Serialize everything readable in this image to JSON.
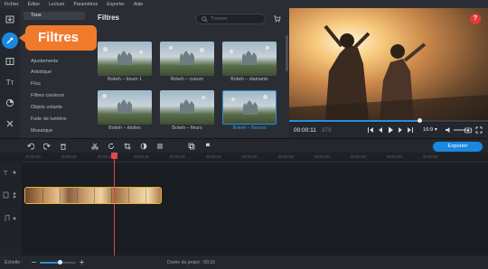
{
  "menu": [
    "Fichier",
    "Éditer",
    "Lecture",
    "Paramètres",
    "Exporter",
    "Aide"
  ],
  "tools": [
    {
      "name": "import-icon"
    },
    {
      "name": "filters-tool-icon",
      "active": true
    },
    {
      "name": "transitions-icon"
    },
    {
      "name": "titles-icon",
      "label": "Tт"
    },
    {
      "name": "stickers-icon"
    },
    {
      "name": "more-tools-icon"
    }
  ],
  "categories": [
    "Tous",
    "Ajustements",
    "Artistique",
    "Flou",
    "Filtres couleurs",
    "Objets volants",
    "Fuite de lumière",
    "Mosaïque"
  ],
  "filters_panel": {
    "title": "Filtres",
    "search_placeholder": "Trouver",
    "items": [
      {
        "label": "Bokeh – boum 1",
        "selected": false
      },
      {
        "label": "Bokeh – coeurs",
        "selected": false
      },
      {
        "label": "Bokeh – diamants",
        "selected": false
      },
      {
        "label": "Bokeh – étoiles",
        "selected": false
      },
      {
        "label": "Bokeh – fleurs",
        "selected": false
      },
      {
        "label": "Bokeh – flocons",
        "selected": true
      }
    ]
  },
  "callout": {
    "text": "Filtres"
  },
  "preview": {
    "help": "?",
    "progress": 0.655,
    "timecode": "00:00:11",
    "timecode_fraction": ".379",
    "aspect_ratio": "16:9 ▾"
  },
  "timeline": {
    "export_label": "Exporter",
    "ruler": [
      "00:00:00",
      "00:00:05",
      "00:00:10",
      "00:00:15",
      "00:00:20",
      "00:00:25",
      "00:00:30",
      "00:00:35",
      "00:00:40",
      "00:00:45",
      "00:00:50",
      "00:00:55"
    ]
  },
  "status": {
    "scale_label": "Échelle :",
    "zoom": 0.55,
    "duration": "Durée du projet : 00:16"
  },
  "colors": {
    "accent": "#1a88e0",
    "callout": "#f07a2c",
    "clip_border": "#e0b43a",
    "playhead": "#e24848"
  }
}
